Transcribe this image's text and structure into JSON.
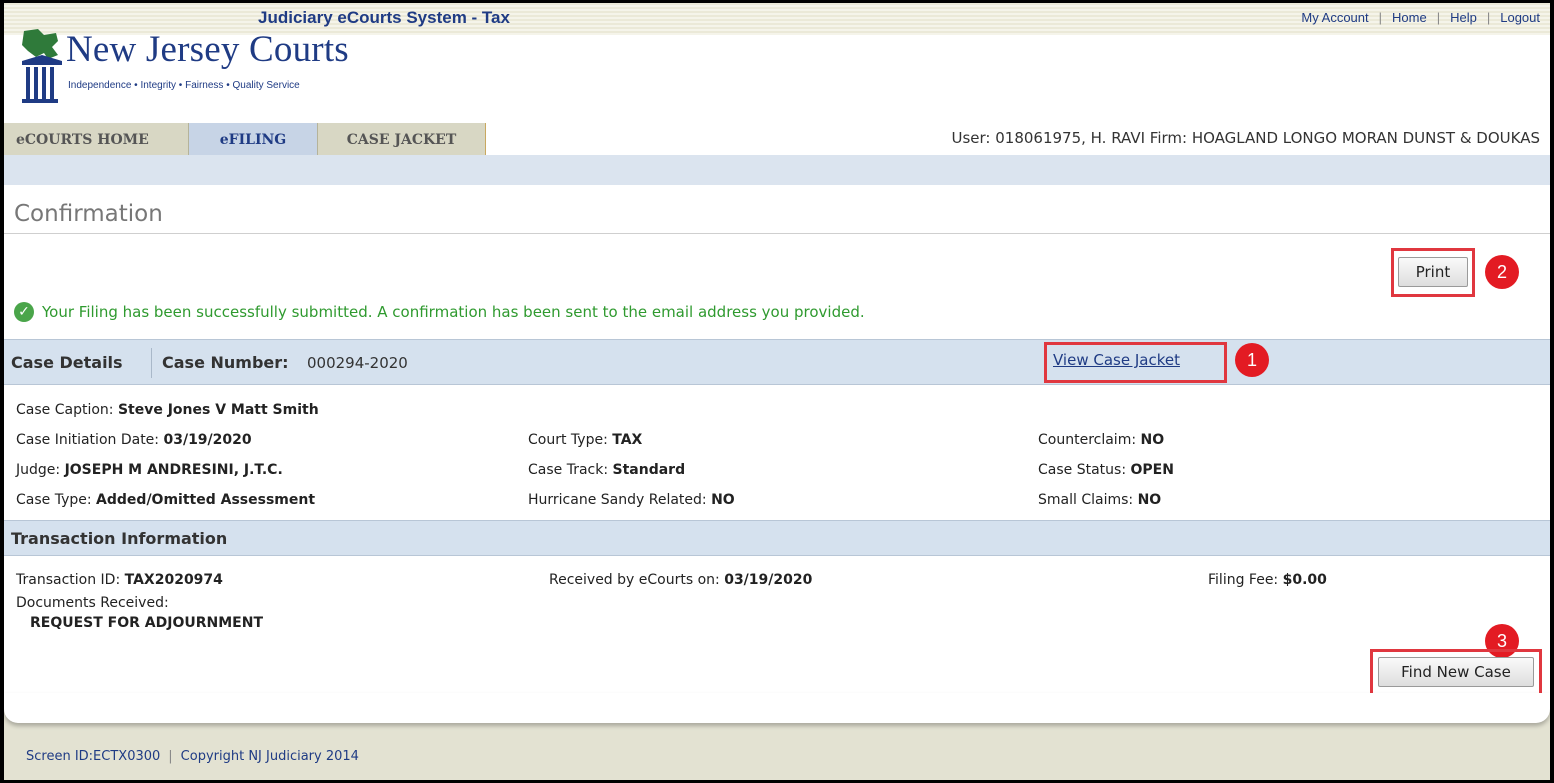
{
  "header": {
    "system_title": "Judiciary eCourts System - Tax",
    "links": [
      "My Account",
      "Home",
      "Help",
      "Logout"
    ]
  },
  "logo": {
    "name": "New Jersey Courts",
    "tagline": "Independence • Integrity • Fairness • Quality Service"
  },
  "nav": {
    "tabs": [
      {
        "label": "eCOURTS HOME",
        "active": false
      },
      {
        "label": "eFILING",
        "active": true
      },
      {
        "label": "CASE JACKET",
        "active": false
      }
    ],
    "user_info": "User: 018061975, H. RAVI  Firm: HOAGLAND LONGO MORAN DUNST & DOUKAS"
  },
  "page": {
    "title": "Confirmation",
    "print_label": "Print",
    "success_message": "Your Filing has been successfully submitted. A confirmation has been sent to the email address you provided."
  },
  "case_details": {
    "section_title": "Case Details",
    "case_number_label": "Case Number:",
    "case_number": "000294-2020",
    "view_jacket_label": "View Case Jacket",
    "caption_label": "Case Caption:",
    "caption": "Steve Jones V Matt Smith",
    "initiation_label": "Case Initiation Date:",
    "initiation_date": "03/19/2020",
    "judge_label": "Judge:",
    "judge": "JOSEPH M ANDRESINI, J.T.C.",
    "case_type_label": "Case Type:",
    "case_type": "Added/Omitted Assessment",
    "court_type_label": "Court Type:",
    "court_type": "TAX",
    "case_track_label": "Case Track:",
    "case_track": "Standard",
    "hurricane_label": "Hurricane Sandy Related:",
    "hurricane": "NO",
    "counterclaim_label": "Counterclaim:",
    "counterclaim": "NO",
    "status_label": "Case Status:",
    "status": "OPEN",
    "small_claims_label": "Small Claims:",
    "small_claims": "NO"
  },
  "transaction": {
    "section_title": "Transaction Information",
    "id_label": "Transaction ID:",
    "id": "TAX2020974",
    "received_label": "Received by eCourts on:",
    "received": "03/19/2020",
    "fee_label": "Filing Fee:",
    "fee": "$0.00",
    "docs_label": "Documents Received:",
    "docs": [
      "REQUEST FOR ADJOURNMENT"
    ],
    "find_new_case_label": "Find New Case"
  },
  "annotations": {
    "badge_1": "1",
    "badge_2": "2",
    "badge_3": "3",
    "highlight_color": "#e0373f"
  },
  "footer": {
    "screen_id": "Screen ID:ECTX0300",
    "copyright": "Copyright NJ Judiciary 2014"
  }
}
